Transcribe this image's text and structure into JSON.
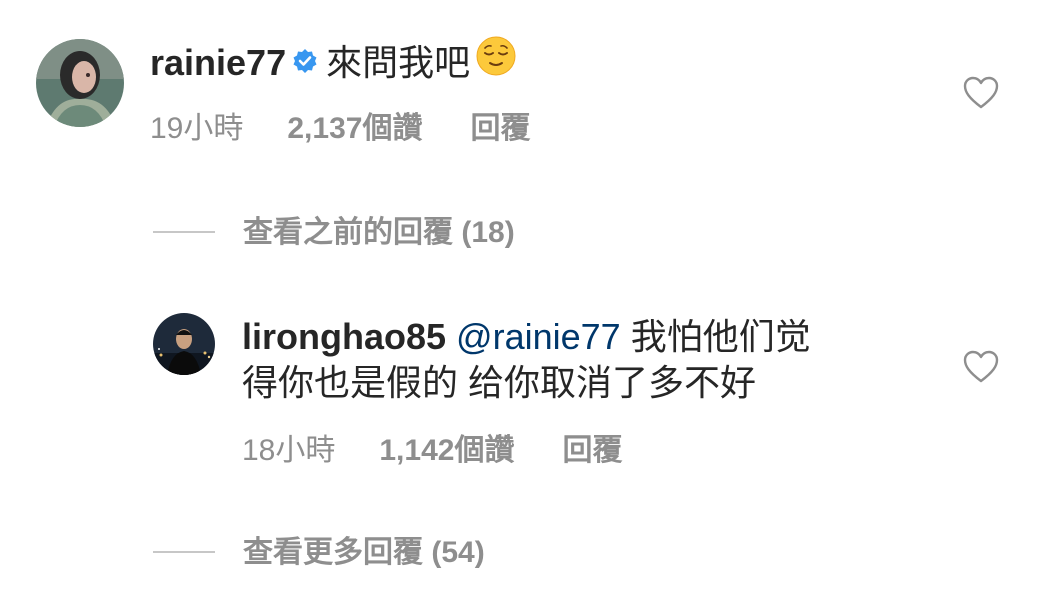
{
  "comment": {
    "username": "rainie77",
    "verified_icon": "verified-badge-icon",
    "text": "來問我吧",
    "emoji": "relieved-face-emoji",
    "time": "19小時",
    "likes": "2,137個讚",
    "reply_label": "回覆",
    "view_previous_replies": "查看之前的回覆 (18)"
  },
  "reply": {
    "username": "lironghao85",
    "mention": "@rainie77",
    "text_line1": "我怕他们觉",
    "text_line2": "得你也是假的 给你取消了多不好",
    "time": "18小時",
    "likes": "1,142個讚",
    "reply_label": "回覆",
    "view_more_replies": "查看更多回覆 (54)"
  },
  "colors": {
    "text": "#262626",
    "secondary": "#8e8e8e",
    "mention": "#00376b",
    "verified": "#3897f0"
  }
}
